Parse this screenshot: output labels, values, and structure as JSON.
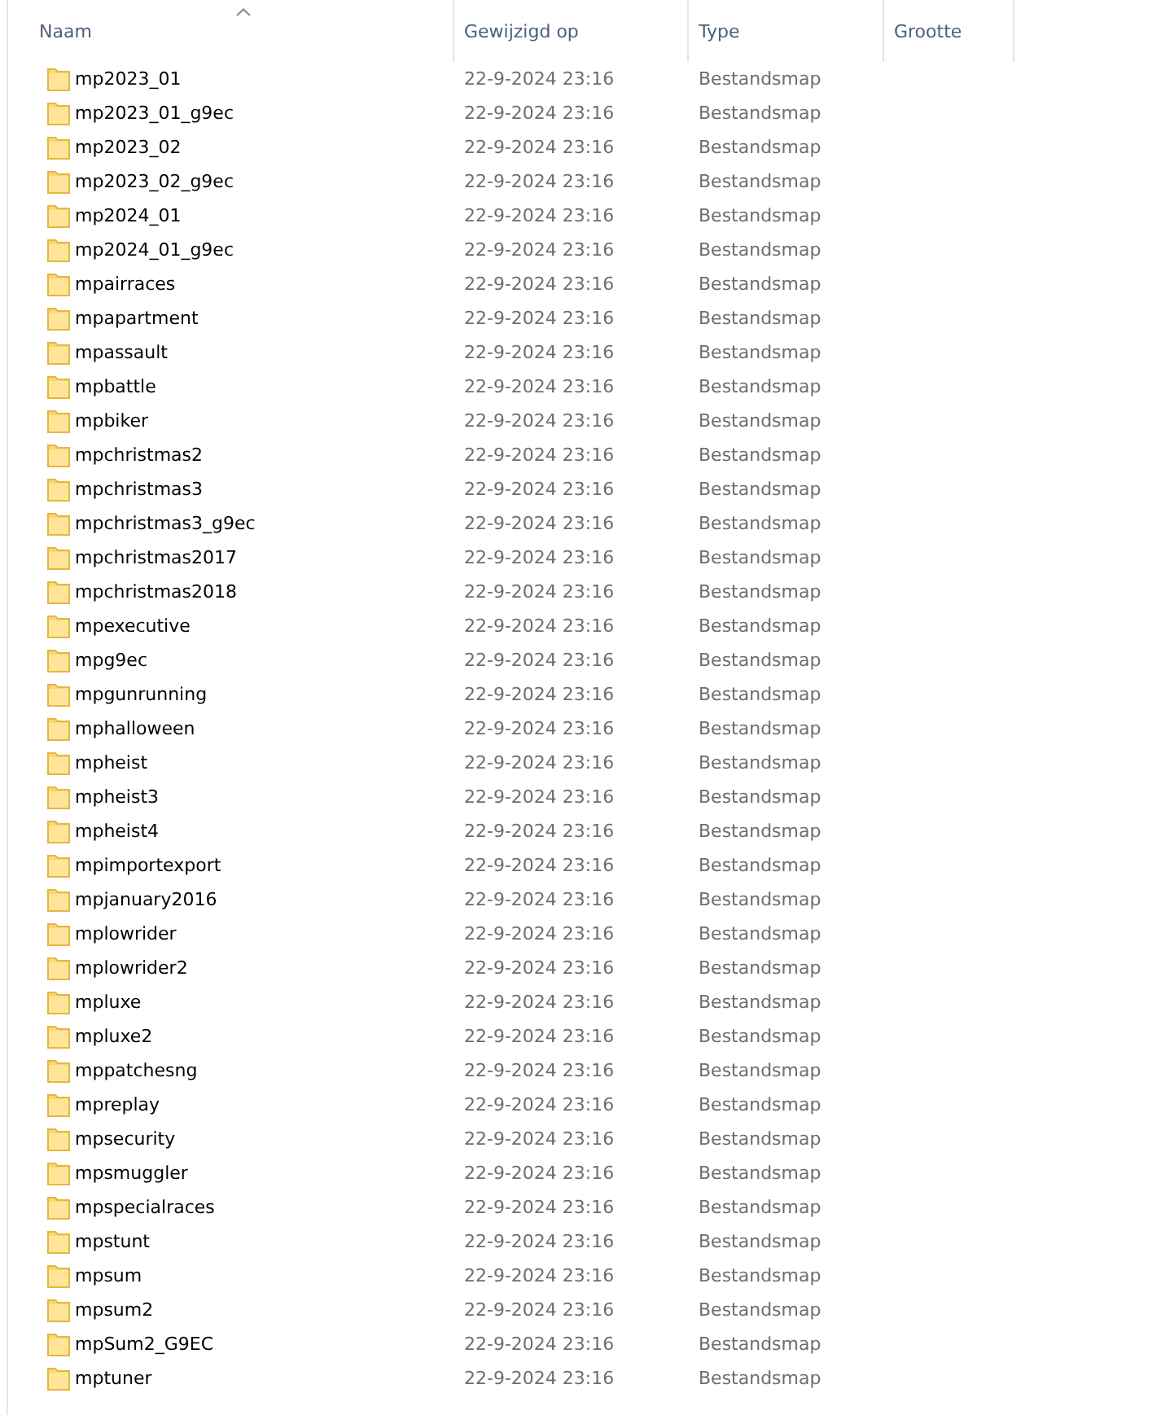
{
  "columns": [
    {
      "label": "Naam",
      "sorted": true
    },
    {
      "label": "Gewijzigd op",
      "sorted": false
    },
    {
      "label": "Type",
      "sorted": false
    },
    {
      "label": "Grootte",
      "sorted": false
    }
  ],
  "rows": [
    {
      "name": "mp2023_01",
      "modified": "22-9-2024 23:16",
      "type": "Bestandsmap"
    },
    {
      "name": "mp2023_01_g9ec",
      "modified": "22-9-2024 23:16",
      "type": "Bestandsmap"
    },
    {
      "name": "mp2023_02",
      "modified": "22-9-2024 23:16",
      "type": "Bestandsmap"
    },
    {
      "name": "mp2023_02_g9ec",
      "modified": "22-9-2024 23:16",
      "type": "Bestandsmap"
    },
    {
      "name": "mp2024_01",
      "modified": "22-9-2024 23:16",
      "type": "Bestandsmap"
    },
    {
      "name": "mp2024_01_g9ec",
      "modified": "22-9-2024 23:16",
      "type": "Bestandsmap"
    },
    {
      "name": "mpairraces",
      "modified": "22-9-2024 23:16",
      "type": "Bestandsmap"
    },
    {
      "name": "mpapartment",
      "modified": "22-9-2024 23:16",
      "type": "Bestandsmap"
    },
    {
      "name": "mpassault",
      "modified": "22-9-2024 23:16",
      "type": "Bestandsmap"
    },
    {
      "name": "mpbattle",
      "modified": "22-9-2024 23:16",
      "type": "Bestandsmap"
    },
    {
      "name": "mpbiker",
      "modified": "22-9-2024 23:16",
      "type": "Bestandsmap"
    },
    {
      "name": "mpchristmas2",
      "modified": "22-9-2024 23:16",
      "type": "Bestandsmap"
    },
    {
      "name": "mpchristmas3",
      "modified": "22-9-2024 23:16",
      "type": "Bestandsmap"
    },
    {
      "name": "mpchristmas3_g9ec",
      "modified": "22-9-2024 23:16",
      "type": "Bestandsmap"
    },
    {
      "name": "mpchristmas2017",
      "modified": "22-9-2024 23:16",
      "type": "Bestandsmap"
    },
    {
      "name": "mpchristmas2018",
      "modified": "22-9-2024 23:16",
      "type": "Bestandsmap"
    },
    {
      "name": "mpexecutive",
      "modified": "22-9-2024 23:16",
      "type": "Bestandsmap"
    },
    {
      "name": "mpg9ec",
      "modified": "22-9-2024 23:16",
      "type": "Bestandsmap"
    },
    {
      "name": "mpgunrunning",
      "modified": "22-9-2024 23:16",
      "type": "Bestandsmap"
    },
    {
      "name": "mphalloween",
      "modified": "22-9-2024 23:16",
      "type": "Bestandsmap"
    },
    {
      "name": "mpheist",
      "modified": "22-9-2024 23:16",
      "type": "Bestandsmap"
    },
    {
      "name": "mpheist3",
      "modified": "22-9-2024 23:16",
      "type": "Bestandsmap"
    },
    {
      "name": "mpheist4",
      "modified": "22-9-2024 23:16",
      "type": "Bestandsmap"
    },
    {
      "name": "mpimportexport",
      "modified": "22-9-2024 23:16",
      "type": "Bestandsmap"
    },
    {
      "name": "mpjanuary2016",
      "modified": "22-9-2024 23:16",
      "type": "Bestandsmap"
    },
    {
      "name": "mplowrider",
      "modified": "22-9-2024 23:16",
      "type": "Bestandsmap"
    },
    {
      "name": "mplowrider2",
      "modified": "22-9-2024 23:16",
      "type": "Bestandsmap"
    },
    {
      "name": "mpluxe",
      "modified": "22-9-2024 23:16",
      "type": "Bestandsmap"
    },
    {
      "name": "mpluxe2",
      "modified": "22-9-2024 23:16",
      "type": "Bestandsmap"
    },
    {
      "name": "mppatchesng",
      "modified": "22-9-2024 23:16",
      "type": "Bestandsmap"
    },
    {
      "name": "mpreplay",
      "modified": "22-9-2024 23:16",
      "type": "Bestandsmap"
    },
    {
      "name": "mpsecurity",
      "modified": "22-9-2024 23:16",
      "type": "Bestandsmap"
    },
    {
      "name": "mpsmuggler",
      "modified": "22-9-2024 23:16",
      "type": "Bestandsmap"
    },
    {
      "name": "mpspecialraces",
      "modified": "22-9-2024 23:16",
      "type": "Bestandsmap"
    },
    {
      "name": "mpstunt",
      "modified": "22-9-2024 23:16",
      "type": "Bestandsmap"
    },
    {
      "name": "mpsum",
      "modified": "22-9-2024 23:16",
      "type": "Bestandsmap"
    },
    {
      "name": "mpsum2",
      "modified": "22-9-2024 23:16",
      "type": "Bestandsmap"
    },
    {
      "name": "mpSum2_G9EC",
      "modified": "22-9-2024 23:16",
      "type": "Bestandsmap"
    },
    {
      "name": "mptuner",
      "modified": "22-9-2024 23:16",
      "type": "Bestandsmap"
    }
  ]
}
